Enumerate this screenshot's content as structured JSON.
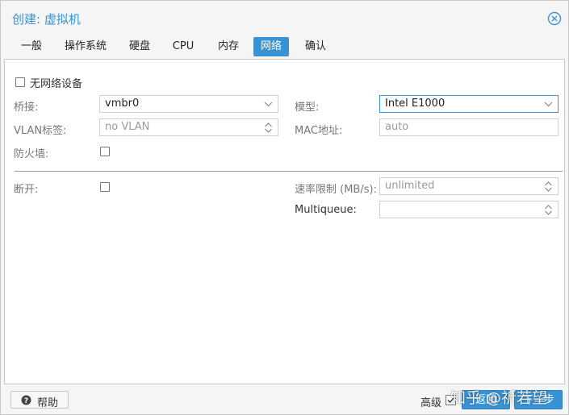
{
  "window": {
    "title": "创建: 虚拟机"
  },
  "tabs": [
    {
      "label": "一般"
    },
    {
      "label": "操作系统"
    },
    {
      "label": "硬盘"
    },
    {
      "label": "CPU"
    },
    {
      "label": "内存"
    },
    {
      "label": "网络",
      "active": true
    },
    {
      "label": "确认"
    }
  ],
  "form": {
    "no_network_label": "无网络设备",
    "bridge": {
      "label": "桥接:",
      "value": "vmbr0"
    },
    "vlan": {
      "label": "VLAN标签:",
      "placeholder": "no VLAN"
    },
    "firewall": {
      "label": "防火墙:"
    },
    "model": {
      "label": "模型:",
      "value": "Intel E1000"
    },
    "mac": {
      "label": "MAC地址:",
      "placeholder": "auto"
    },
    "disconnect": {
      "label": "断开:"
    },
    "rate_limit": {
      "label": "速率限制 (MB/s):",
      "placeholder": "unlimited"
    },
    "multiqueue": {
      "label": "Multiqueue:",
      "value": ""
    }
  },
  "footer": {
    "help_label": "帮助",
    "advanced_label": "高级",
    "back_label": "返回",
    "next_label": "下一步"
  },
  "watermark": "知乎 @祈若望",
  "colors": {
    "accent": "#3892d4"
  }
}
